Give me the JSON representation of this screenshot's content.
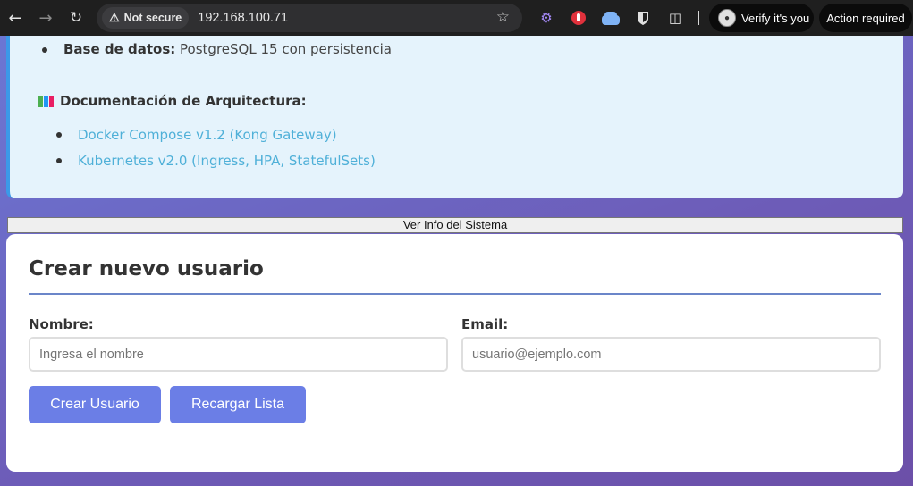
{
  "browser": {
    "security_label": "Not secure",
    "url": "192.168.100.71",
    "verify_label": "Verify it's you",
    "action_label": "Action required",
    "colors": {
      "chrome_bg": "#1f1f1f",
      "omnibox_bg": "#2f2f31"
    }
  },
  "info": {
    "db_label": "Base de datos:",
    "db_value": " PostgreSQL 15 con persistencia",
    "doc_title": "Documentación de Arquitectura:",
    "doc_links": [
      "Docker Compose v1.2 (Kong Gateway)",
      "Kubernetes v2.0 (Ingress, HPA, StatefulSets)"
    ],
    "colors": {
      "card_bg": "#e5f3fc",
      "accent_border": "#3b99e8",
      "link": "#4fb0d8"
    }
  },
  "toggle": {
    "label": "Ver Info del Sistema"
  },
  "form": {
    "title": "Crear nuevo usuario",
    "name_label": "Nombre:",
    "name_placeholder": "Ingresa el nombre",
    "email_label": "Email:",
    "email_placeholder": "usuario@ejemplo.com",
    "create_button": "Crear Usuario",
    "reload_button": "Recargar Lista",
    "colors": {
      "button_bg": "#6b7ee6",
      "title_rule": "#6b86c9"
    }
  }
}
